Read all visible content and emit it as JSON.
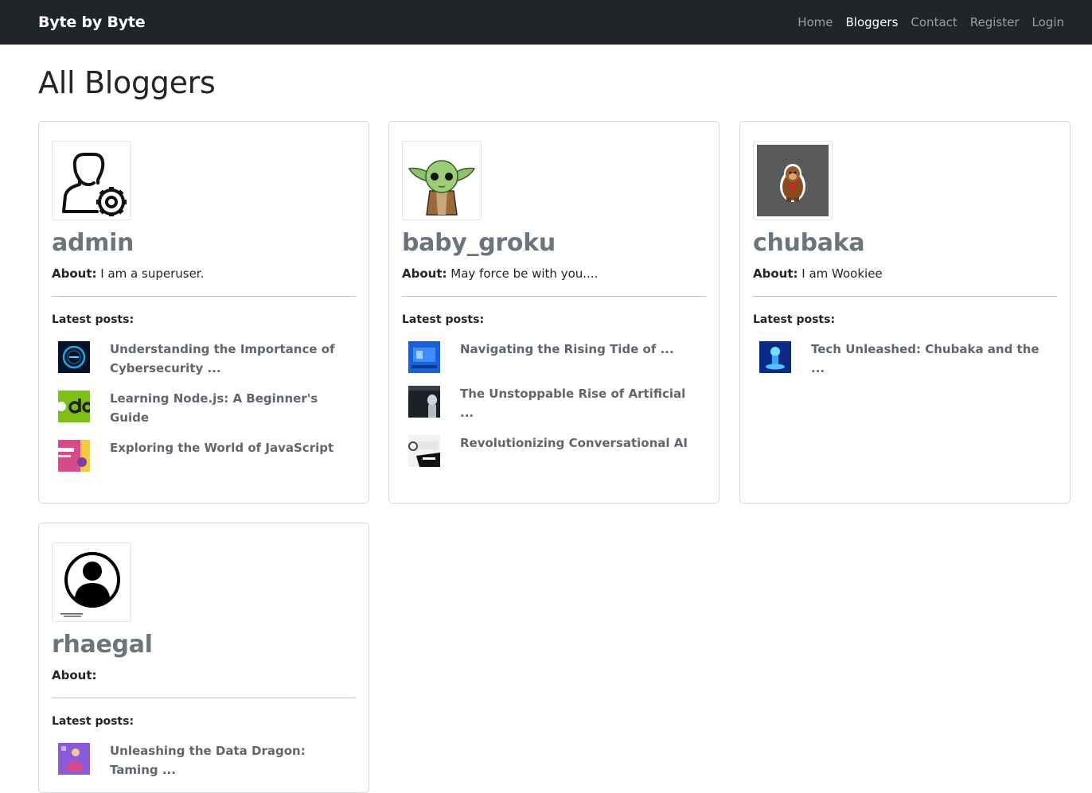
{
  "navbar": {
    "brand": "Byte by Byte",
    "links": [
      {
        "label": "Home"
      },
      {
        "label": "Bloggers"
      },
      {
        "label": "Contact"
      },
      {
        "label": "Register"
      },
      {
        "label": "Login"
      }
    ]
  },
  "page": {
    "title": "All Bloggers"
  },
  "bloggers": [
    {
      "username": "admin",
      "about_label": "About:",
      "about": "I am a superuser.",
      "avatar_icon": "user-gear-icon",
      "latest_label": "Latest posts:",
      "posts": [
        {
          "title": "Understanding the Importance of Cybersecurity ...",
          "thumb": "cybersecurity-thumb"
        },
        {
          "title": "Learning Node.js: A Beginner's Guide",
          "thumb": "nodejs-thumb"
        },
        {
          "title": "Exploring the World of JavaScript",
          "thumb": "javascript-thumb"
        }
      ]
    },
    {
      "username": "baby_groku",
      "about_label": "About:",
      "about": "May force be with you....",
      "avatar_icon": "baby-yoda-icon",
      "latest_label": "Latest posts:",
      "posts": [
        {
          "title": "Navigating the Rising Tide of ...",
          "thumb": "tech-thumb"
        },
        {
          "title": "The Unstoppable Rise of Artificial ...",
          "thumb": "robot-thumb"
        },
        {
          "title": "Revolutionizing Conversational AI",
          "thumb": "openai-thumb"
        }
      ]
    },
    {
      "username": "chubaka",
      "about_label": "About:",
      "about": "I am Wookiee",
      "avatar_icon": "wookiee-icon",
      "latest_label": "Latest posts:",
      "posts": [
        {
          "title": "Tech Unleashed: Chubaka and the ...",
          "thumb": "hologram-thumb"
        }
      ]
    },
    {
      "username": "rhaegal",
      "about_label": "About:",
      "about": "",
      "avatar_icon": "user-circle-icon",
      "latest_label": "Latest posts:",
      "posts": [
        {
          "title": "Unleashing the Data Dragon: Taming ...",
          "thumb": "data-dragon-thumb"
        }
      ]
    }
  ]
}
